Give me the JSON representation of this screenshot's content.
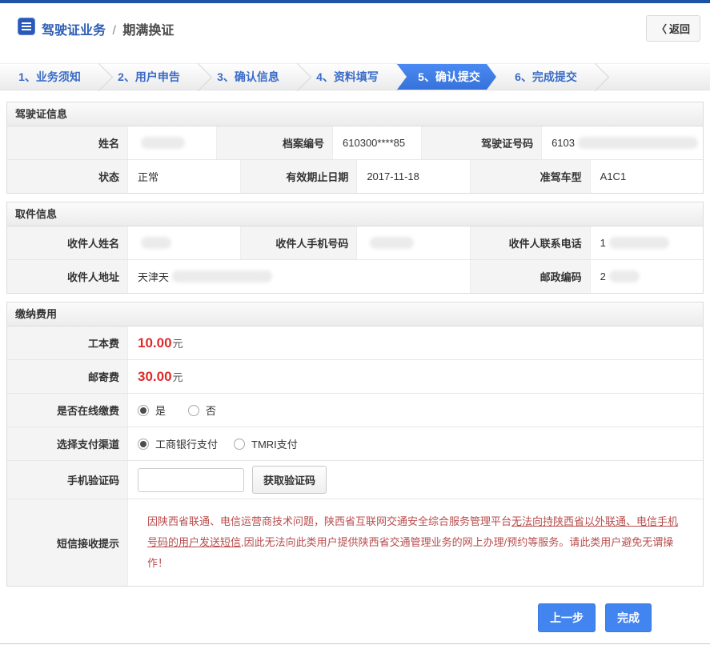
{
  "colors": {
    "top_bar_blue": "#1e52a6",
    "title_blue": "#2b5db5",
    "step_text_blue": "#3a6cc8",
    "active_step_blue": "#3e7ee9",
    "fee_red": "#e02a2a",
    "notice_red": "#b84c4c",
    "action_button_blue": "#4285f0"
  },
  "header": {
    "title_primary": "驾驶证业务",
    "title_separator": "/",
    "title_secondary": "期满换证",
    "back_icon": "〈",
    "back_label": "返回"
  },
  "steps": [
    {
      "label": "1、业务须知"
    },
    {
      "label": "2、用户申告"
    },
    {
      "label": "3、确认信息"
    },
    {
      "label": "4、资料填写"
    },
    {
      "label": "5、确认提交"
    },
    {
      "label": "6、完成提交"
    }
  ],
  "active_step": "5、确认提交",
  "license_section": {
    "title": "驾驶证信息",
    "row1": {
      "name_label": "姓名",
      "name_value": "",
      "file_no_label": "档案编号",
      "file_no_value": "610300****85",
      "license_no_label": "驾驶证号码",
      "license_no_value": "6103"
    },
    "row2": {
      "status_label": "状态",
      "status_value": "正常",
      "expiry_label": "有效期止日期",
      "expiry_value": "2017-11-18",
      "vehicle_label": "准驾车型",
      "vehicle_value": "A1C1"
    }
  },
  "pickup_section": {
    "title": "取件信息",
    "row1": {
      "recipient_label": "收件人姓名",
      "recipient_value": "",
      "mobile_label": "收件人手机号码",
      "mobile_value": "",
      "phone_label": "收件人联系电话",
      "phone_value": "1"
    },
    "row2": {
      "address_label": "收件人地址",
      "address_value": "天津天",
      "postal_label": "邮政编码",
      "postal_value": "2"
    }
  },
  "fees_section": {
    "title": "缴纳费用",
    "production_fee": {
      "label": "工本费",
      "amount": "10.00",
      "unit": "元"
    },
    "mailing_fee": {
      "label": "邮寄费",
      "amount": "30.00",
      "unit": "元"
    },
    "online_payment": {
      "label": "是否在线缴费",
      "option_yes": "是",
      "option_no": "否",
      "selected": "是"
    },
    "payment_channel": {
      "label": "选择支付渠道",
      "option_icbc": "工商银行支付",
      "option_tmri": "TMRI支付",
      "selected": "工商银行支付"
    },
    "sms_code": {
      "label": "手机验证码",
      "input_value": "",
      "button_label": "获取验证码"
    },
    "sms_notice": {
      "label": "短信接收提示",
      "text_before": "因陕西省联通、电信运营商技术问题，陕西省互联网交通安全综合服务管理平台",
      "text_underlined": "无法向持陕西省以外联通、电信手机号码的用户发送短信",
      "text_after": ",因此无法向此类用户提供陕西省交通管理业务的网上办理/预约等服务。请此类用户避免无谓操作！"
    }
  },
  "footer": {
    "prev_label": "上一步",
    "finish_label": "完成"
  }
}
